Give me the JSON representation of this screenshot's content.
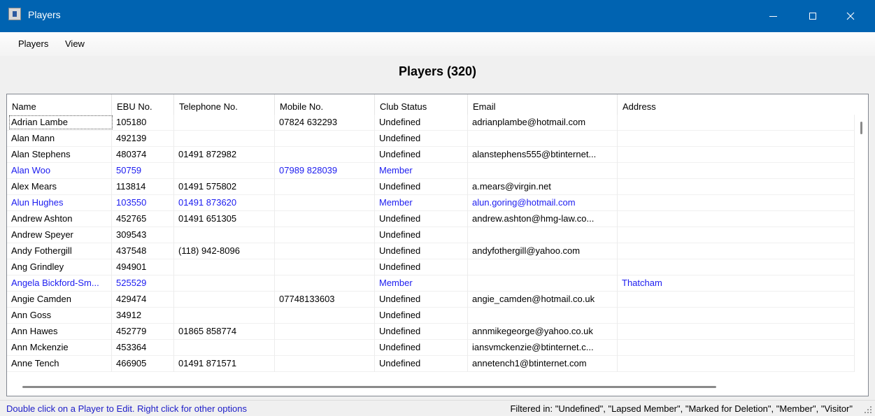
{
  "window": {
    "title": "Players"
  },
  "menu": {
    "items": [
      "Players",
      "View"
    ]
  },
  "heading": "Players  (320)",
  "table": {
    "columns": [
      "Name",
      "EBU No.",
      "Telephone No.",
      "Mobile No.",
      "Club Status",
      "Email",
      "Address"
    ],
    "rows": [
      {
        "cells": [
          "Adrian Lambe",
          "105180",
          "",
          "07824 632293",
          "Undefined",
          "adrianplambe@hotmail.com",
          ""
        ],
        "status": "Undefined"
      },
      {
        "cells": [
          "Alan Mann",
          "492139",
          "",
          "",
          "Undefined",
          "",
          ""
        ],
        "status": "Undefined"
      },
      {
        "cells": [
          "Alan Stephens",
          "480374",
          "01491 872982",
          "",
          "Undefined",
          "alanstephens555@btinternet...",
          ""
        ],
        "status": "Undefined"
      },
      {
        "cells": [
          "Alan Woo",
          "50759",
          "",
          "07989 828039",
          "Member",
          "",
          ""
        ],
        "status": "Member"
      },
      {
        "cells": [
          "Alex Mears",
          "113814",
          "01491 575802",
          "",
          "Undefined",
          "a.mears@virgin.net",
          ""
        ],
        "status": "Undefined"
      },
      {
        "cells": [
          "Alun Hughes",
          "103550",
          "01491 873620",
          "",
          "Member",
          "alun.goring@hotmail.com",
          ""
        ],
        "status": "Member"
      },
      {
        "cells": [
          "Andrew Ashton",
          "452765",
          "01491 651305",
          "",
          "Undefined",
          "andrew.ashton@hmg-law.co...",
          ""
        ],
        "status": "Undefined"
      },
      {
        "cells": [
          "Andrew Speyer",
          "309543",
          "",
          "",
          "Undefined",
          "",
          ""
        ],
        "status": "Undefined"
      },
      {
        "cells": [
          "Andy Fothergill",
          "437548",
          "(118) 942-8096",
          "",
          "Undefined",
          "andyfothergill@yahoo.com",
          ""
        ],
        "status": "Undefined"
      },
      {
        "cells": [
          "Ang Grindley",
          "494901",
          "",
          "",
          "Undefined",
          "",
          ""
        ],
        "status": "Undefined"
      },
      {
        "cells": [
          "Angela Bickford-Sm...",
          "525529",
          "",
          "",
          "Member",
          "",
          "Thatcham"
        ],
        "status": "Member"
      },
      {
        "cells": [
          "Angie Camden",
          "429474",
          "",
          "07748133603",
          "Undefined",
          "angie_camden@hotmail.co.uk",
          ""
        ],
        "status": "Undefined"
      },
      {
        "cells": [
          "Ann Goss",
          "34912",
          "",
          "",
          "Undefined",
          "",
          ""
        ],
        "status": "Undefined"
      },
      {
        "cells": [
          "Ann Hawes",
          "452779",
          "01865 858774",
          "",
          "Undefined",
          "annmikegeorge@yahoo.co.uk",
          ""
        ],
        "status": "Undefined"
      },
      {
        "cells": [
          "Ann Mckenzie",
          "453364",
          "",
          "",
          "Undefined",
          "iansvmckenzie@btinternet.c...",
          ""
        ],
        "status": "Undefined"
      },
      {
        "cells": [
          "Anne Tench",
          "466905",
          "01491 871571",
          "",
          "Undefined",
          "annetench1@btinternet.com",
          ""
        ],
        "status": "Undefined"
      }
    ]
  },
  "status": {
    "left": "Double click on a Player to Edit.  Right click for other options",
    "right": "Filtered in:  \"Undefined\", \"Lapsed Member\", \"Marked for Deletion\", \"Member\", \"Visitor\""
  },
  "colors": {
    "titlebar": "#0063b1",
    "member_text": "#1c1cf0",
    "status_link": "#1c1cc8"
  },
  "icons": [
    "app-icon",
    "minimize-icon",
    "maximize-icon",
    "close-icon",
    "resize-grip-icon"
  ]
}
